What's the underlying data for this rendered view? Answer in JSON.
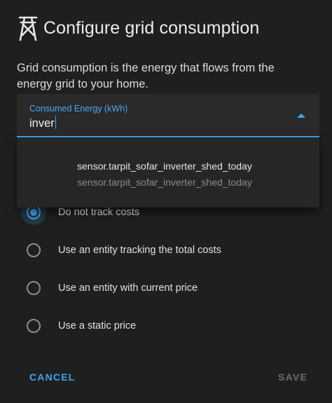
{
  "dialog": {
    "title": "Configure grid consumption",
    "title_icon": "transmission-tower-icon",
    "description": "Grid consumption is the energy that flows from the energy grid to your home."
  },
  "field": {
    "label": "Consumed Energy (kWh)",
    "value": "inver"
  },
  "dropdown": {
    "items": [
      {
        "primary": "sensor.tarpit_sofar_inverter_shed_today",
        "secondary": "sensor.tarpit_sofar_inverter_shed_today"
      }
    ]
  },
  "cost_options": [
    {
      "label": "Do not track costs",
      "checked": true
    },
    {
      "label": "Use an entity tracking the total costs",
      "checked": false
    },
    {
      "label": "Use an entity with current price",
      "checked": false
    },
    {
      "label": "Use a static price",
      "checked": false
    }
  ],
  "actions": {
    "cancel": "CANCEL",
    "save": "SAVE"
  },
  "colors": {
    "accent": "#3ea6f0",
    "background": "#1f1f1f",
    "disabled": "#6b6b6b"
  }
}
